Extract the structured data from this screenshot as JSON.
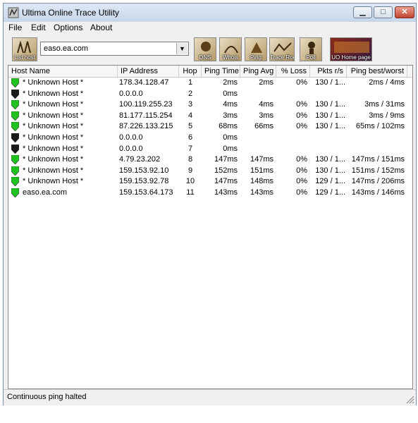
{
  "window": {
    "title": "Ultima Online Trace Utility",
    "min_glyph": "▁",
    "max_glyph": "□",
    "close_glyph": "✕"
  },
  "menu": [
    "File",
    "Edit",
    "Options",
    "About"
  ],
  "toolbar": {
    "host_value": "easo.ea.com",
    "buttons": [
      {
        "name": "list-host",
        "label": "List host"
      },
      {
        "name": "dns",
        "label": "DNS"
      },
      {
        "name": "whois",
        "label": "Whois"
      },
      {
        "name": "ping",
        "label": "Ping"
      },
      {
        "name": "trace-route",
        "label": "Trace Route"
      },
      {
        "name": "poll",
        "label": "Poll"
      },
      {
        "name": "uo-home-page",
        "label": "UO Home page"
      }
    ]
  },
  "columns": [
    "Host Name",
    "IP Address",
    "Hop",
    "Ping Time",
    "Ping Avg",
    "% Loss",
    "Pkts r/s",
    "Ping best/worst"
  ],
  "rows": [
    {
      "status": "green",
      "host": "* Unknown Host *",
      "ip": "178.34.128.47",
      "hop": "1",
      "ping_time": "2ms",
      "ping_avg": "2ms",
      "loss": "0%",
      "pkts": "130 / 1...",
      "best_worst": "2ms / 4ms"
    },
    {
      "status": "black",
      "host": "* Unknown Host *",
      "ip": "0.0.0.0",
      "hop": "2",
      "ping_time": "0ms",
      "ping_avg": "",
      "loss": "",
      "pkts": "",
      "best_worst": ""
    },
    {
      "status": "green",
      "host": "* Unknown Host *",
      "ip": "100.119.255.23",
      "hop": "3",
      "ping_time": "4ms",
      "ping_avg": "4ms",
      "loss": "0%",
      "pkts": "130 / 1...",
      "best_worst": "3ms / 31ms"
    },
    {
      "status": "green",
      "host": "* Unknown Host *",
      "ip": "81.177.115.254",
      "hop": "4",
      "ping_time": "3ms",
      "ping_avg": "3ms",
      "loss": "0%",
      "pkts": "130 / 1...",
      "best_worst": "3ms / 9ms"
    },
    {
      "status": "green",
      "host": "* Unknown Host *",
      "ip": "87.226.133.215",
      "hop": "5",
      "ping_time": "68ms",
      "ping_avg": "66ms",
      "loss": "0%",
      "pkts": "130 / 1...",
      "best_worst": "65ms / 102ms"
    },
    {
      "status": "black",
      "host": "* Unknown Host *",
      "ip": "0.0.0.0",
      "hop": "6",
      "ping_time": "0ms",
      "ping_avg": "",
      "loss": "",
      "pkts": "",
      "best_worst": ""
    },
    {
      "status": "black",
      "host": "* Unknown Host *",
      "ip": "0.0.0.0",
      "hop": "7",
      "ping_time": "0ms",
      "ping_avg": "",
      "loss": "",
      "pkts": "",
      "best_worst": ""
    },
    {
      "status": "green",
      "host": "* Unknown Host *",
      "ip": "4.79.23.202",
      "hop": "8",
      "ping_time": "147ms",
      "ping_avg": "147ms",
      "loss": "0%",
      "pkts": "130 / 1...",
      "best_worst": "147ms / 151ms"
    },
    {
      "status": "green",
      "host": "* Unknown Host *",
      "ip": "159.153.92.10",
      "hop": "9",
      "ping_time": "152ms",
      "ping_avg": "151ms",
      "loss": "0%",
      "pkts": "130 / 1...",
      "best_worst": "151ms / 152ms"
    },
    {
      "status": "green",
      "host": "* Unknown Host *",
      "ip": "159.153.92.78",
      "hop": "10",
      "ping_time": "147ms",
      "ping_avg": "148ms",
      "loss": "0%",
      "pkts": "129 / 1...",
      "best_worst": "147ms / 206ms"
    },
    {
      "status": "green",
      "host": "easo.ea.com",
      "ip": "159.153.64.173",
      "hop": "11",
      "ping_time": "143ms",
      "ping_avg": "143ms",
      "loss": "0%",
      "pkts": "129 / 1...",
      "best_worst": "143ms / 146ms"
    }
  ],
  "status_text": "Continuous ping halted",
  "colors": {
    "shield_green": "#1fc21f",
    "shield_black": "#1a1a1a"
  }
}
